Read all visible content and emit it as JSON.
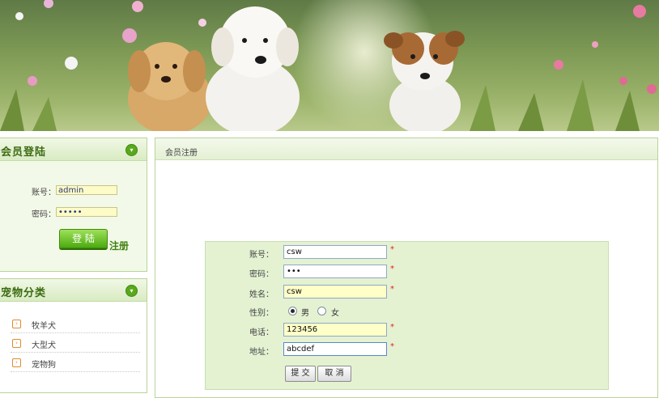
{
  "login": {
    "title": "会员登陆",
    "account_label": "账号：",
    "account_value": "admin",
    "password_label": "密码：",
    "password_value": "•••••",
    "login_button": "登 陆",
    "register_link": "注册"
  },
  "categories": {
    "title": "宠物分类",
    "items": [
      {
        "label": "牧羊犬"
      },
      {
        "label": "大型犬"
      },
      {
        "label": "宠物狗"
      }
    ]
  },
  "register": {
    "title": "会员注册",
    "fields": {
      "account": {
        "label": "账号：",
        "value": "csw",
        "required": "*"
      },
      "password": {
        "label": "密码：",
        "value": "•••",
        "required": "*"
      },
      "name": {
        "label": "姓名：",
        "value": "csw",
        "required": "*"
      },
      "gender": {
        "label": "性别：",
        "male": "男",
        "female": "女"
      },
      "phone": {
        "label": "电话：",
        "value": "123456",
        "required": "*"
      },
      "address": {
        "label": "地址：",
        "value": "abcdef",
        "required": "*"
      }
    },
    "submit_button": "提 交",
    "cancel_button": "取 消"
  },
  "icons": {
    "panel_toggle": "chevron-down-icon",
    "category_bullet": "arrow-right-box-icon"
  },
  "colors": {
    "accent": "#5aa81d",
    "panel_border": "#b8d498",
    "form_bg": "#e4f2d2",
    "required": "#e02020"
  }
}
